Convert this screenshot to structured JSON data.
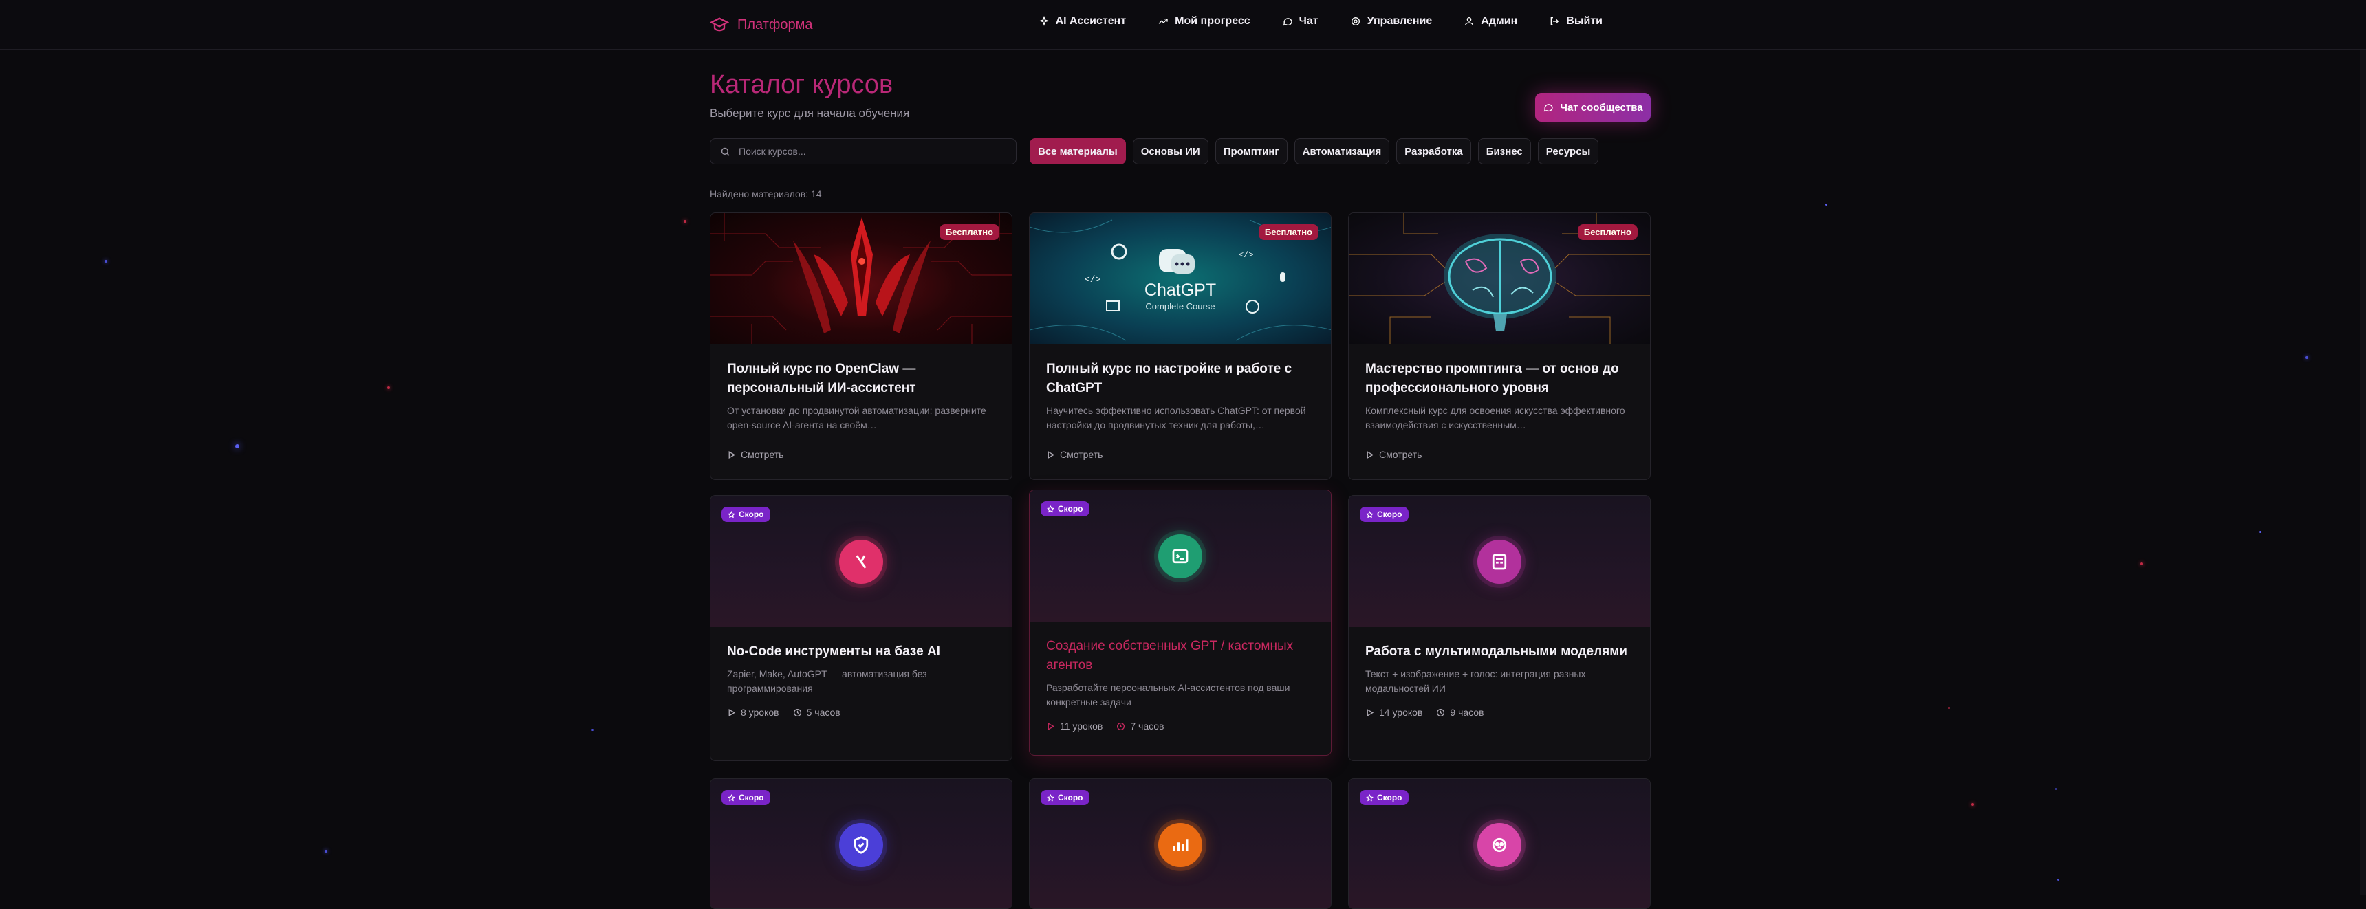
{
  "nav": {
    "brand": "Платформа",
    "items": [
      {
        "label": "AI Ассистент",
        "icon": "sparkles-icon"
      },
      {
        "label": "Мой прогресс",
        "icon": "trending-up-icon"
      },
      {
        "label": "Чат",
        "icon": "chat-bubble-icon"
      },
      {
        "label": "Управление",
        "icon": "gear-icon"
      },
      {
        "label": "Админ",
        "icon": "user-icon"
      },
      {
        "label": "Выйти",
        "icon": "logout-icon"
      }
    ]
  },
  "header": {
    "title": "Каталог курсов",
    "subtitle": "Выберите курс для начала обучения",
    "community_button": "Чат сообщества"
  },
  "search": {
    "placeholder": "Поиск курсов..."
  },
  "filters": [
    "Все материалы",
    "Основы ИИ",
    "Промптинг",
    "Автоматизация",
    "Разработка",
    "Бизнес",
    "Ресурсы"
  ],
  "found": "Найдено материалов: 14",
  "cards": [
    {
      "badge": "Бесплатно",
      "title": "Полный курс по OpenClaw — персональный ИИ-ассистент",
      "desc": "От установки до продвинутой автоматизации: разверните open-source AI-агента на своём…",
      "action": "Смотреть",
      "thumb": "openclaw-red"
    },
    {
      "badge": "Бесплатно",
      "title": "Полный курс по настройке и работе с ChatGPT",
      "desc": "Научитесь эффективно использовать ChatGPT: от первой настройки до продвинутых техник для работы,…",
      "action": "Смотреть",
      "thumb": "chatgpt",
      "thumb_title": "ChatGPT",
      "thumb_sub": "Complete Course"
    },
    {
      "badge": "Бесплатно",
      "title": "Мастерство промптинга — от основ до профессионального уровня",
      "desc": "Комплексный курс для освоения искусства эффективного взаимодействия с искусственным…",
      "action": "Смотреть",
      "thumb": "brain"
    },
    {
      "badge": "Скоро",
      "title": "No-Code инструменты на базе AI",
      "desc": "Zapier, Make, AutoGPT — автоматизация без программирования",
      "lessons": "8 уроков",
      "hours": "5 часов",
      "icon": "tool-icon",
      "icon_color": "#e0306a"
    },
    {
      "badge": "Скоро",
      "title": "Создание собственных GPT / кастомных агентов",
      "desc": "Разработайте персональных AI-ассистентов под ваши конкретные задачи",
      "lessons": "11 уроков",
      "hours": "7 часов",
      "icon": "terminal-icon",
      "icon_color": "#1f9e72"
    },
    {
      "badge": "Скоро",
      "title": "Работа с мультимодальными моделями",
      "desc": "Текст + изображение + голос: интеграция разных модальностей ИИ",
      "lessons": "14 уроков",
      "hours": "9 часов",
      "icon": "media-icon",
      "icon_color": "#b2319c"
    },
    {
      "badge": "Скоро",
      "icon": "shield-icon",
      "icon_color": "#4b3fd8"
    },
    {
      "badge": "Скоро",
      "icon": "bar-chart-icon",
      "icon_color": "#ea6a12"
    },
    {
      "badge": "Скоро",
      "icon": "robot-icon",
      "icon_color": "#d845a8"
    }
  ]
}
